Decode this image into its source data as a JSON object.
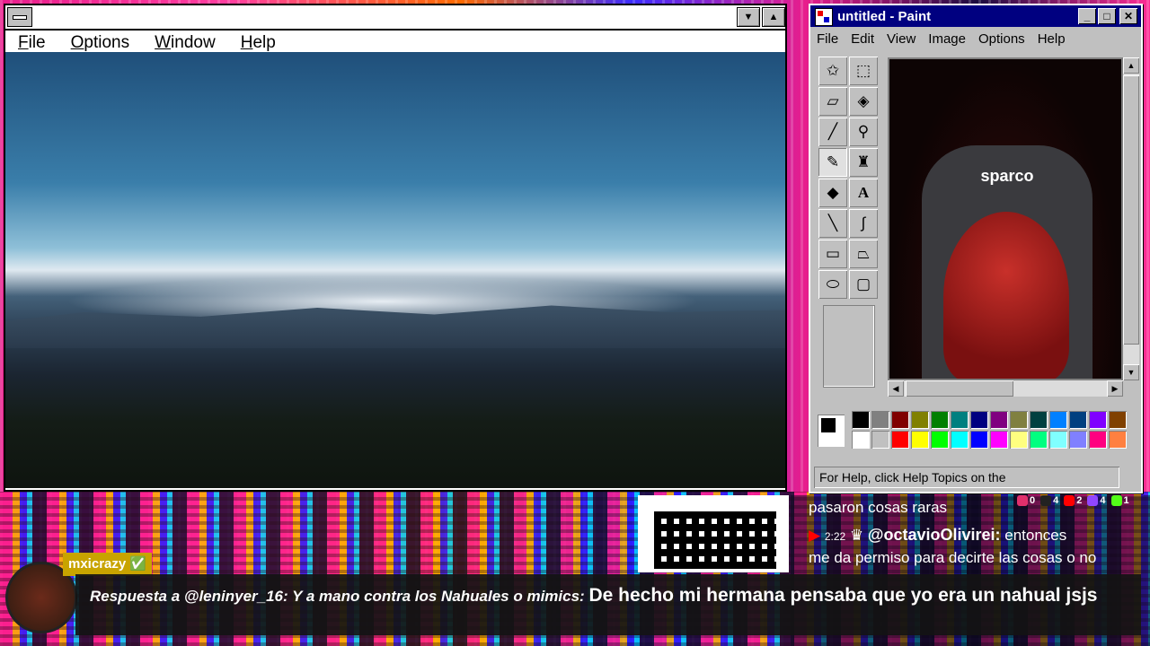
{
  "main_window": {
    "menu": [
      "File",
      "Options",
      "Window",
      "Help"
    ]
  },
  "paint_window": {
    "title": "untitled - Paint",
    "menu": [
      "File",
      "Edit",
      "View",
      "Image",
      "Options",
      "Help"
    ],
    "status": "For Help, click Help Topics on the",
    "canvas_label": "sparco",
    "palette": [
      "#000000",
      "#808080",
      "#800000",
      "#808000",
      "#008000",
      "#008080",
      "#000080",
      "#800080",
      "#808040",
      "#004040",
      "#0080ff",
      "#004080",
      "#8000ff",
      "#804000",
      "#ffffff",
      "#c0c0c0",
      "#ff0000",
      "#ffff00",
      "#00ff00",
      "#00ffff",
      "#0000ff",
      "#ff00ff",
      "#ffff80",
      "#00ff80",
      "#80ffff",
      "#8080ff",
      "#ff0080",
      "#ff8040"
    ]
  },
  "chat": {
    "line1": "pasaron cosas raras",
    "time": "2:22",
    "user2": "@octavioOlivirei:",
    "text2a": "entonces",
    "text2b": "me da permiso para decirte las cosas o no",
    "counts": {
      "instagram": "0",
      "tiktok": "4",
      "youtube": "2",
      "twitch": "4",
      "kick": "1"
    }
  },
  "caption": {
    "user": "mxicrazy",
    "reply": "Respuesta a @leninyer_16: Y a mano contra los Nahuales o mimics:",
    "message": "De hecho mi hermana pensaba que yo era un nahual jsjs"
  }
}
